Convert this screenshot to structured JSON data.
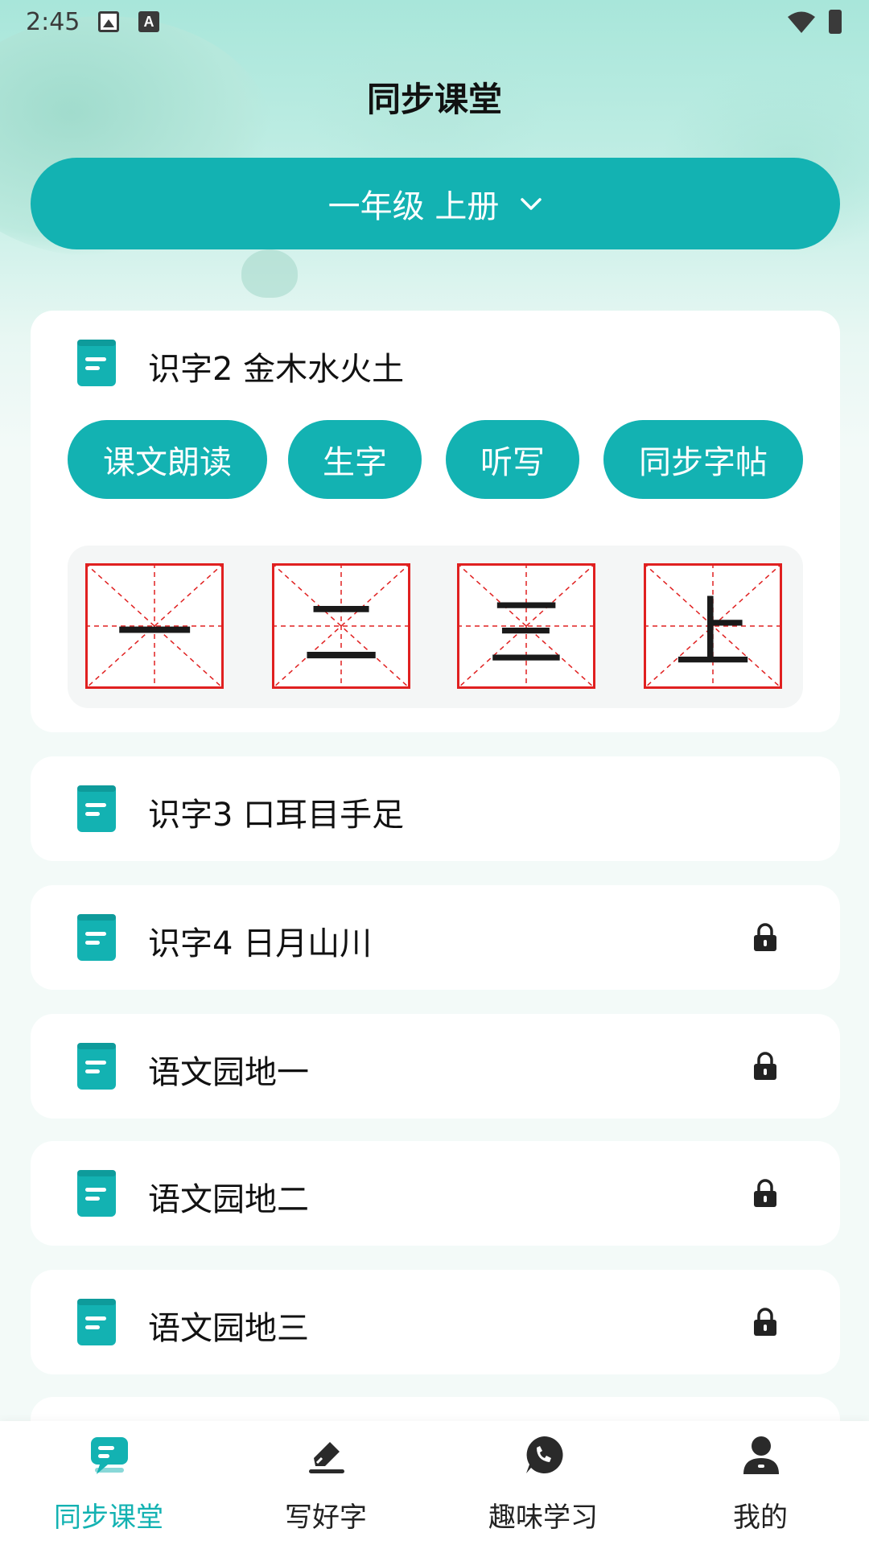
{
  "status_bar": {
    "time": "2:45",
    "icons": [
      "image-icon",
      "keyboard-a-icon",
      "wifi-icon",
      "battery-charging-icon"
    ]
  },
  "header": {
    "title": "同步课堂"
  },
  "grade_selector": {
    "label": "一年级 上册",
    "icon": "chevron-down-icon"
  },
  "expanded_lesson": {
    "title": "识字2 金木水火土",
    "icon": "book-icon",
    "actions": [
      "课文朗读",
      "生字",
      "听写",
      "同步字帖"
    ],
    "characters": [
      "一",
      "二",
      "三",
      "上"
    ]
  },
  "lessons": [
    {
      "title": "识字3 口耳目手足",
      "locked": false
    },
    {
      "title": "识字4 日月山川",
      "locked": true
    },
    {
      "title": "语文园地一",
      "locked": true
    },
    {
      "title": "语文园地二",
      "locked": true
    },
    {
      "title": "语文园地三",
      "locked": true
    }
  ],
  "tabbar": {
    "items": [
      {
        "label": "同步课堂",
        "icon": "classroom-chat-icon",
        "active": true
      },
      {
        "label": "写好字",
        "icon": "eraser-write-icon",
        "active": false
      },
      {
        "label": "趣味学习",
        "icon": "phone-bubble-icon",
        "active": false
      },
      {
        "label": "我的",
        "icon": "person-icon",
        "active": false
      }
    ]
  },
  "colors": {
    "accent": "#13b2b2",
    "grid_red": "#e02020",
    "lock": "#222222"
  }
}
